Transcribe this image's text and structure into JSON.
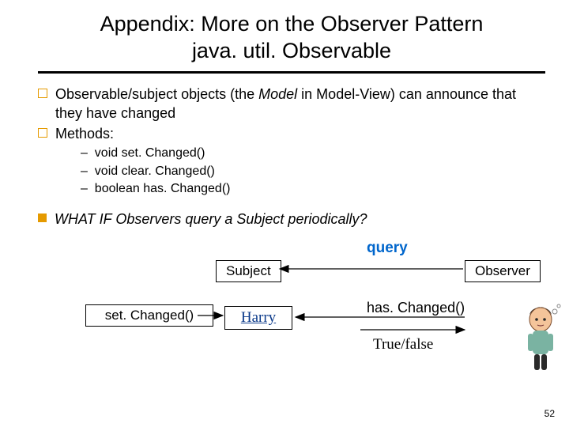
{
  "title_line1": "Appendix: More on the Observer Pattern",
  "title_line2": "java. util. Observable",
  "bullets": {
    "b1_pre": "Observable/subject objects (the ",
    "b1_em": "Model",
    "b1_post": " in Model-View) can announce that they have changed",
    "b2": "Methods:",
    "s1": "void set. Changed()",
    "s2": "void clear. Changed()",
    "s3": "boolean has. Changed()",
    "b3_em": "WHAT IF Observers query a Subject periodically?"
  },
  "diagram": {
    "subject": "Subject",
    "observer": "Observer",
    "setChanged": "set. Changed()",
    "harry": "Harry",
    "query": "query",
    "hasChanged": "has. Changed()",
    "truefalse": "True/false"
  },
  "page": "52"
}
